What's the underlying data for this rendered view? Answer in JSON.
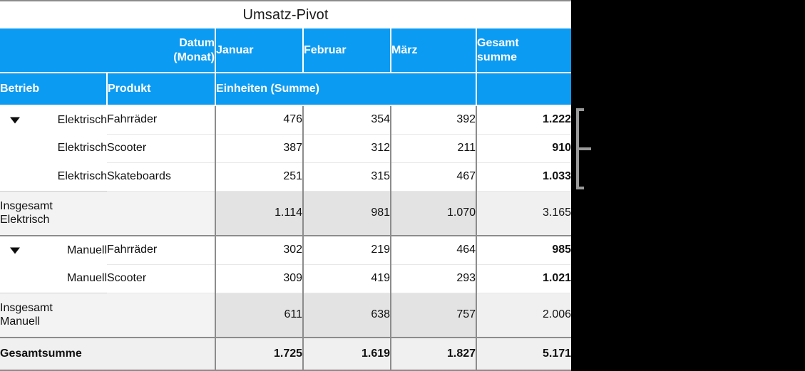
{
  "table": {
    "title": "Umsatz-Pivot",
    "header": {
      "date_field_label": "Datum (Monat)",
      "date_field_line1": "Datum",
      "date_field_line2": "(Monat)",
      "months": [
        "Januar",
        "Februar",
        "März"
      ],
      "grand_total_line1": "Gesamt",
      "grand_total_line2": "summe",
      "row_field_1": "Betrieb",
      "row_field_2": "Produkt",
      "value_field": "Einheiten (Summe)"
    },
    "groups": [
      {
        "name": "Elektrisch",
        "expanded": true,
        "disclosure_icon": "triangle-down-icon",
        "rows": [
          {
            "betrieb": "Elektrisch",
            "produkt": "Fahrräder",
            "januar": "476",
            "februar": "354",
            "maerz": "392",
            "gesamt": "1.222"
          },
          {
            "betrieb": "Elektrisch",
            "produkt": "Scooter",
            "januar": "387",
            "februar": "312",
            "maerz": "211",
            "gesamt": "910"
          },
          {
            "betrieb": "Elektrisch",
            "produkt": "Skateboards",
            "januar": "251",
            "februar": "315",
            "maerz": "467",
            "gesamt": "1.033"
          }
        ],
        "subtotal": {
          "label_line1": "Insgesamt",
          "label_line2": "Elektrisch",
          "januar": "1.114",
          "februar": "981",
          "maerz": "1.070",
          "gesamt": "3.165"
        }
      },
      {
        "name": "Manuell",
        "expanded": true,
        "disclosure_icon": "triangle-down-icon",
        "rows": [
          {
            "betrieb": "Manuell",
            "produkt": "Fahrräder",
            "januar": "302",
            "februar": "219",
            "maerz": "464",
            "gesamt": "985"
          },
          {
            "betrieb": "Manuell",
            "produkt": "Scooter",
            "januar": "309",
            "februar": "419",
            "maerz": "293",
            "gesamt": "1.021"
          }
        ],
        "subtotal": {
          "label_line1": "Insgesamt",
          "label_line2": "Manuell",
          "januar": "611",
          "februar": "638",
          "maerz": "757",
          "gesamt": "2.006"
        }
      }
    ],
    "grand_total": {
      "label": "Gesamtsumme",
      "januar": "1.725",
      "februar": "1.619",
      "maerz": "1.827",
      "gesamt": "5.171"
    }
  },
  "annotation": {
    "bracket_name": "group-bracket-elektrisch"
  },
  "colors": {
    "header_blue": "#0c9bf2",
    "subtotal_gray": "#e3e3e3",
    "total_gray": "#f0f0f0",
    "rule_gray": "#8c8c8c",
    "bracket_gray": "#9a9a9a",
    "background": "#000000"
  }
}
